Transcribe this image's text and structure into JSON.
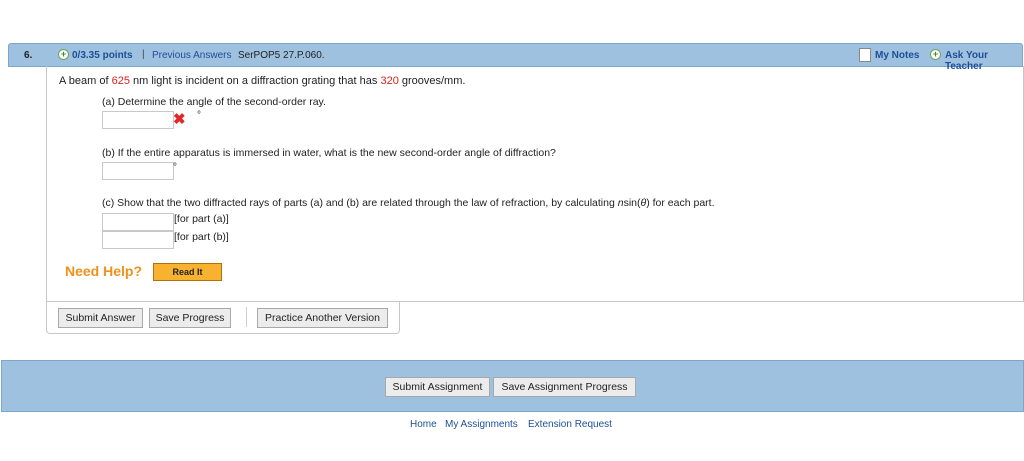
{
  "question": {
    "number": "6.",
    "points": "0/3.35 points",
    "separator": "|",
    "previous_answers": "Previous Answers",
    "code": "SerPOP5 27.P.060.",
    "my_notes": "My Notes",
    "ask_teacher": "Ask Your Teacher"
  },
  "problem": {
    "intro_1": "A beam of ",
    "wavelength": "625",
    "intro_2": " nm light is incident on a diffraction grating that has ",
    "grooves": "320",
    "intro_3": " grooves/mm."
  },
  "parts": {
    "a": {
      "text": "(a) Determine the angle of the second-order ray.",
      "unit": "°",
      "answer": "",
      "status": "incorrect"
    },
    "b": {
      "text": "(b) If the entire apparatus is immersed in water, what is the new second-order angle of diffraction?",
      "unit": "°",
      "answer": ""
    },
    "c": {
      "text_1": "(c) Show that the two diffracted rays of parts (a) and (b) are related through the law of refraction, by calculating ",
      "text_n": "n",
      "text_2": "sin(",
      "text_theta": "θ",
      "text_3": ") for each part.",
      "label_a": "[for part (a)]",
      "label_b": "[for part (b)]",
      "answer_a": "",
      "answer_b": ""
    }
  },
  "help": {
    "label": "Need Help?",
    "read_it": "Read It"
  },
  "buttons": {
    "submit_answer": "Submit Answer",
    "save_progress": "Save Progress",
    "practice": "Practice Another Version"
  },
  "footer": {
    "submit_assignment": "Submit Assignment",
    "save_assignment": "Save Assignment Progress"
  },
  "links": {
    "home": "Home",
    "my_assignments": "My Assignments",
    "extension_request": "Extension Request"
  },
  "colors": {
    "header_blue": "#9ec1df",
    "link_blue": "#1d4f97",
    "incorrect_red": "#e0282b",
    "help_orange": "#f0901a"
  }
}
